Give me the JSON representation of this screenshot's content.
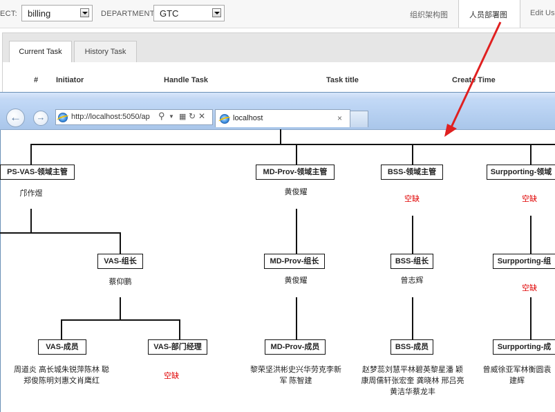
{
  "filters": {
    "project_label": "ECT:",
    "project_value": "billing",
    "department_label": "DEPARTMENT:",
    "department_value": "GTC"
  },
  "top_nav": {
    "org_structure": "组织架构图",
    "personnel_chart": "人员部署图",
    "edit_user": "Edit Us"
  },
  "tasks": {
    "tabs": [
      "Current Task",
      "History Task"
    ],
    "columns": [
      "#",
      "Initiator",
      "Handle Task",
      "Task title",
      "Create Time"
    ]
  },
  "browser": {
    "address": "http://localhost:5050/ap",
    "address_host": "localhost",
    "tab_title": "localhost",
    "tab_close": "×"
  },
  "org_chart": {
    "col1": {
      "manager": "PS-VAS-领域主管",
      "manager_name": "邝作煜",
      "lead": "VAS-组长",
      "lead_name": "蔡仰鹏",
      "member": "VAS-成员",
      "member_names": "周道炎 高长城朱锐萍陈林 聪郑俊陈明刘惠文肖鹰红",
      "dept_manager": "VAS-部门经理",
      "dept_manager_name": "空缺"
    },
    "col2": {
      "manager": "MD-Prov-领域主管",
      "manager_name": "黄俊耀",
      "lead": "MD-Prov-组长",
      "lead_name": "黄俊耀",
      "member": "MD-Prov-成员",
      "member_names": "黎荣坚洪彬史兴华劳克李新 军 陈智建"
    },
    "col3": {
      "manager": "BSS-领域主管",
      "manager_name": "空缺",
      "lead": "BSS-组长",
      "lead_name": "曾志辉",
      "member": "BSS-成员",
      "member_names": "赵梦蕊刘慧平林碧英黎星潘 颖康周儒轩张宏奎 龚晓林 邢吕亮黄洁华蔡龙丰"
    },
    "col4": {
      "manager": "Surpporting-领域",
      "manager_name": "空缺",
      "lead": "Surpporting-组",
      "lead_name": "空缺",
      "member": "Surpporting-成",
      "member_names": "曾威徐亚军林衡圆袁 建辉"
    }
  },
  "colors": {
    "vacant": "#e00000",
    "annotation_arrow": "#e02020",
    "browser_chrome": "#b8d2f2"
  }
}
